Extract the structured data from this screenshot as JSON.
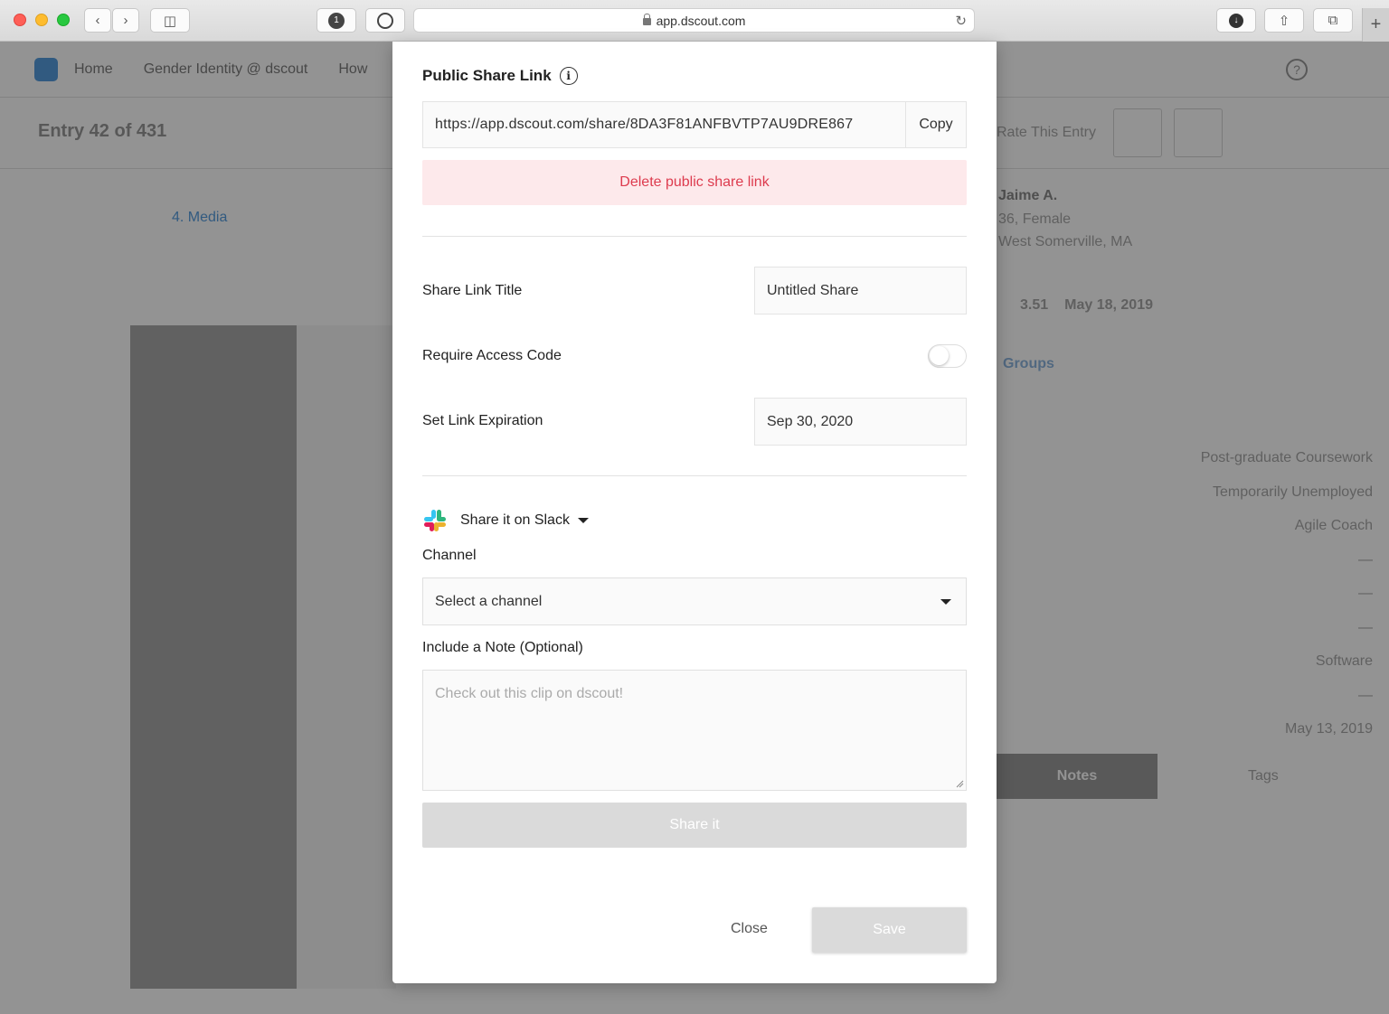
{
  "browser": {
    "url": "app.dscout.com",
    "badge_count": "1"
  },
  "background": {
    "nav": [
      "Home",
      "Gender Identity @ dscout",
      "How"
    ],
    "entry_label": "Entry 42 of 431",
    "media_label": "4. Media",
    "rate_label": "Rate This Entry",
    "profile_name": "Jaime A.",
    "profile_age": "36, Female",
    "profile_location": "West Somerville, MA",
    "stats": [
      "3.51",
      "May 18, 2019"
    ],
    "groups_label": "Groups",
    "attributes": [
      "Post-graduate Coursework",
      "Temporarily Unemployed",
      "Agile Coach",
      "—",
      "—",
      "—",
      "Software",
      "—",
      "May 13, 2019"
    ],
    "notes_tab": "Notes",
    "tags_tab": "Tags"
  },
  "modal": {
    "public_share_title": "Public Share Link",
    "share_url": "https://app.dscout.com/share/8DA3F81ANFBVTP7AU9DRE867",
    "copy_label": "Copy",
    "delete_label": "Delete public share link",
    "title_label": "Share Link Title",
    "title_value": "Untitled Share",
    "access_code_label": "Require Access Code",
    "access_code_enabled": false,
    "expiration_label": "Set Link Expiration",
    "expiration_value": "Sep 30, 2020",
    "slack_label": "Share it on Slack",
    "channel_label": "Channel",
    "channel_placeholder": "Select a channel",
    "note_label": "Include a Note (Optional)",
    "note_placeholder": "Check out this clip on dscout!",
    "share_label": "Share it",
    "close_label": "Close",
    "save_label": "Save"
  },
  "colors": {
    "delete_bg": "#fde9eb",
    "delete_text": "#dd3b4e",
    "disabled_button": "#dadada"
  }
}
